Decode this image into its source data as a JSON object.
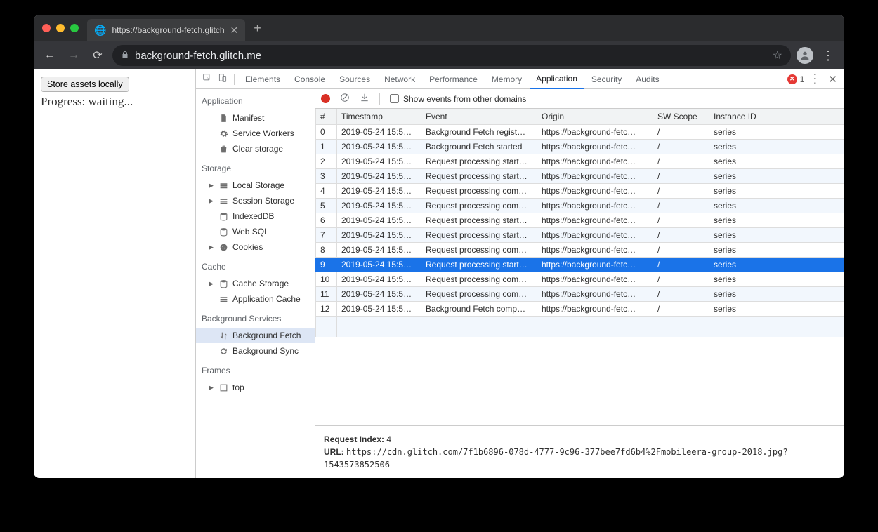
{
  "browser": {
    "tab_title": "https://background-fetch.glitch",
    "url_display_host": "background-fetch.glitch.me",
    "url_display_prefix": ""
  },
  "page": {
    "button_label": "Store assets locally",
    "progress_text": "Progress: waiting..."
  },
  "devtools": {
    "tabs": [
      "Elements",
      "Console",
      "Sources",
      "Network",
      "Performance",
      "Memory",
      "Application",
      "Security",
      "Audits"
    ],
    "active_tab": "Application",
    "error_count": "1",
    "sidebar": {
      "groups": [
        {
          "header": "Application",
          "items": [
            {
              "icon": "file",
              "label": "Manifest"
            },
            {
              "icon": "gear",
              "label": "Service Workers"
            },
            {
              "icon": "trash",
              "label": "Clear storage"
            }
          ]
        },
        {
          "header": "Storage",
          "items": [
            {
              "icon": "stack",
              "label": "Local Storage",
              "expand": true
            },
            {
              "icon": "stack",
              "label": "Session Storage",
              "expand": true
            },
            {
              "icon": "db",
              "label": "IndexedDB"
            },
            {
              "icon": "db",
              "label": "Web SQL"
            },
            {
              "icon": "cookie",
              "label": "Cookies",
              "expand": true
            }
          ]
        },
        {
          "header": "Cache",
          "items": [
            {
              "icon": "db",
              "label": "Cache Storage",
              "expand": true
            },
            {
              "icon": "stack",
              "label": "Application Cache"
            }
          ]
        },
        {
          "header": "Background Services",
          "items": [
            {
              "icon": "updown",
              "label": "Background Fetch",
              "selected": true
            },
            {
              "icon": "sync",
              "label": "Background Sync"
            }
          ]
        },
        {
          "header": "Frames",
          "items": [
            {
              "icon": "frame",
              "label": "top",
              "expand": true
            }
          ]
        }
      ]
    },
    "toolbar": {
      "show_other_label": "Show events from other domains"
    },
    "columns": [
      "#",
      "Timestamp",
      "Event",
      "Origin",
      "SW Scope",
      "Instance ID"
    ],
    "rows": [
      {
        "n": "0",
        "ts": "2019-05-24 15:5…",
        "ev": "Background Fetch regist…",
        "or": "https://background-fetc…",
        "sw": "/",
        "id": "series"
      },
      {
        "n": "1",
        "ts": "2019-05-24 15:5…",
        "ev": "Background Fetch started",
        "or": "https://background-fetc…",
        "sw": "/",
        "id": "series"
      },
      {
        "n": "2",
        "ts": "2019-05-24 15:5…",
        "ev": "Request processing start…",
        "or": "https://background-fetc…",
        "sw": "/",
        "id": "series"
      },
      {
        "n": "3",
        "ts": "2019-05-24 15:5…",
        "ev": "Request processing start…",
        "or": "https://background-fetc…",
        "sw": "/",
        "id": "series"
      },
      {
        "n": "4",
        "ts": "2019-05-24 15:5…",
        "ev": "Request processing com…",
        "or": "https://background-fetc…",
        "sw": "/",
        "id": "series"
      },
      {
        "n": "5",
        "ts": "2019-05-24 15:5…",
        "ev": "Request processing com…",
        "or": "https://background-fetc…",
        "sw": "/",
        "id": "series"
      },
      {
        "n": "6",
        "ts": "2019-05-24 15:5…",
        "ev": "Request processing start…",
        "or": "https://background-fetc…",
        "sw": "/",
        "id": "series"
      },
      {
        "n": "7",
        "ts": "2019-05-24 15:5…",
        "ev": "Request processing start…",
        "or": "https://background-fetc…",
        "sw": "/",
        "id": "series"
      },
      {
        "n": "8",
        "ts": "2019-05-24 15:5…",
        "ev": "Request processing com…",
        "or": "https://background-fetc…",
        "sw": "/",
        "id": "series"
      },
      {
        "n": "9",
        "ts": "2019-05-24 15:5…",
        "ev": "Request processing start…",
        "or": "https://background-fetc…",
        "sw": "/",
        "id": "series",
        "selected": true
      },
      {
        "n": "10",
        "ts": "2019-05-24 15:5…",
        "ev": "Request processing com…",
        "or": "https://background-fetc…",
        "sw": "/",
        "id": "series"
      },
      {
        "n": "11",
        "ts": "2019-05-24 15:5…",
        "ev": "Request processing com…",
        "or": "https://background-fetc…",
        "sw": "/",
        "id": "series"
      },
      {
        "n": "12",
        "ts": "2019-05-24 15:5…",
        "ev": "Background Fetch comp…",
        "or": "https://background-fetc…",
        "sw": "/",
        "id": "series"
      }
    ],
    "details": {
      "request_index_label": "Request Index:",
      "request_index_value": "4",
      "url_label": "URL:",
      "url_value": "https://cdn.glitch.com/7f1b6896-078d-4777-9c96-377bee7fd6b4%2Fmobileera-group-2018.jpg?1543573852506"
    }
  }
}
